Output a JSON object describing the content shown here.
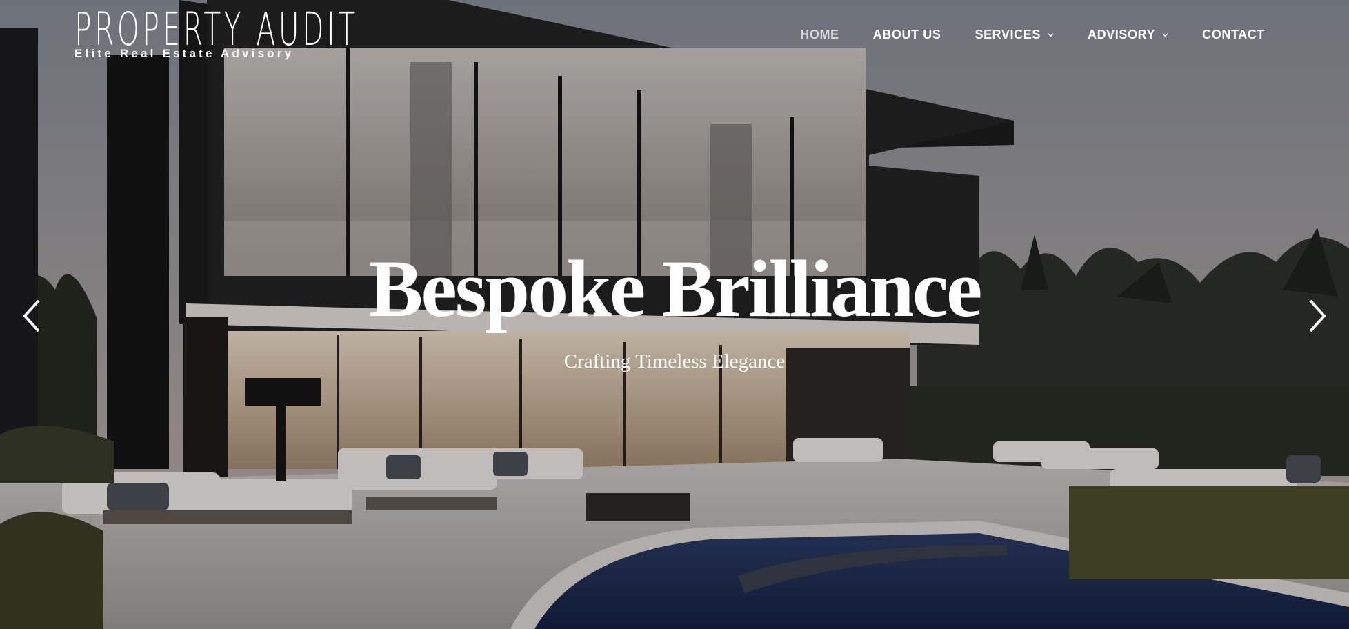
{
  "brand": {
    "name": "PROPERTY AUDIT",
    "tagline": "Elite Real Estate Advisory"
  },
  "nav": {
    "home": "HOME",
    "about": "ABOUT US",
    "services": "SERVICES",
    "advisory": "ADVISORY",
    "contact": "CONTACT"
  },
  "hero": {
    "headline": "Bespoke Brilliance",
    "subheadline": "Crafting Timeless Elegance",
    "prev_icon": "chevron-left-icon",
    "next_icon": "chevron-right-icon"
  },
  "colors": {
    "text": "#ffffff",
    "active_nav": "#d8d8d8",
    "sky": "#9aa0aa",
    "pool": "#1d2a4a"
  }
}
